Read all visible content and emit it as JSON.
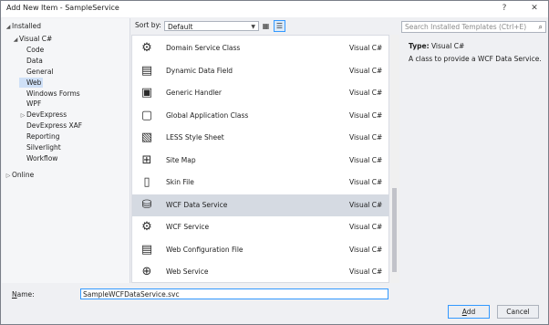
{
  "window": {
    "title": "Add New Item - SampleService",
    "help_glyph": "?",
    "close_glyph": "✕"
  },
  "tree": {
    "header": "Installed",
    "items": [
      {
        "label": "Visual C#",
        "indent": 1,
        "expander": "◢",
        "selected": false
      },
      {
        "label": "Code",
        "indent": 2,
        "expander": "",
        "selected": false
      },
      {
        "label": "Data",
        "indent": 2,
        "expander": "",
        "selected": false
      },
      {
        "label": "General",
        "indent": 2,
        "expander": "",
        "selected": false
      },
      {
        "label": "Web",
        "indent": 2,
        "expander": "",
        "selected": true
      },
      {
        "label": "Windows Forms",
        "indent": 2,
        "expander": "",
        "selected": false
      },
      {
        "label": "WPF",
        "indent": 2,
        "expander": "",
        "selected": false
      },
      {
        "label": "DevExpress",
        "indent": 2,
        "expander": "▷",
        "selected": false
      },
      {
        "label": "DevExpress XAF",
        "indent": 2,
        "expander": "",
        "selected": false
      },
      {
        "label": "Reporting",
        "indent": 2,
        "expander": "",
        "selected": false
      },
      {
        "label": "Silverlight",
        "indent": 2,
        "expander": "",
        "selected": false
      },
      {
        "label": "Workflow",
        "indent": 2,
        "expander": "",
        "selected": false
      },
      {
        "label": "Online",
        "indent": 0,
        "expander": "▷",
        "selected": false
      }
    ]
  },
  "toolbar": {
    "sort_label": "Sort by:",
    "sort_value": "Default",
    "small_icons_glyph": "▦",
    "list_glyph": "☰"
  },
  "templates": [
    {
      "name": "Domain Service Class",
      "lang": "Visual C#",
      "icon": "⚙",
      "icon_name": "domain-service-icon",
      "selected": false
    },
    {
      "name": "Dynamic Data Field",
      "lang": "Visual C#",
      "icon": "▤",
      "icon_name": "dynamic-data-field-icon",
      "selected": false
    },
    {
      "name": "Generic Handler",
      "lang": "Visual C#",
      "icon": "▣",
      "icon_name": "generic-handler-icon",
      "selected": false
    },
    {
      "name": "Global Application Class",
      "lang": "Visual C#",
      "icon": "▢",
      "icon_name": "global-application-class-icon",
      "selected": false
    },
    {
      "name": "LESS Style Sheet",
      "lang": "Visual C#",
      "icon": "▧",
      "icon_name": "less-style-sheet-icon",
      "selected": false
    },
    {
      "name": "Site Map",
      "lang": "Visual C#",
      "icon": "⊞",
      "icon_name": "site-map-icon",
      "selected": false
    },
    {
      "name": "Skin File",
      "lang": "Visual C#",
      "icon": "▯",
      "icon_name": "skin-file-icon",
      "selected": false
    },
    {
      "name": "WCF Data Service",
      "lang": "Visual C#",
      "icon": "⛁",
      "icon_name": "wcf-data-service-icon",
      "selected": true
    },
    {
      "name": "WCF Service",
      "lang": "Visual C#",
      "icon": "⚙",
      "icon_name": "wcf-service-icon",
      "selected": false
    },
    {
      "name": "Web Configuration File",
      "lang": "Visual C#",
      "icon": "▤",
      "icon_name": "web-config-file-icon",
      "selected": false
    },
    {
      "name": "Web Service",
      "lang": "Visual C#",
      "icon": "⊕",
      "icon_name": "web-service-icon",
      "selected": false
    }
  ],
  "details": {
    "search_placeholder": "Search Installed Templates (Ctrl+E)",
    "search_glyph": "⌕",
    "type_label": "Type:",
    "type_value": "Visual C#",
    "description": "A class to provide a WCF Data Service."
  },
  "footer": {
    "name_label_first": "N",
    "name_label_rest": "ame:",
    "name_value": "SampleWCFDataService.svc",
    "add_first": "A",
    "add_rest": "dd",
    "cancel": "Cancel"
  },
  "colors": {
    "accent": "#3399ff",
    "selection": "#cfe0f7",
    "list_selection": "#d5dae2"
  }
}
